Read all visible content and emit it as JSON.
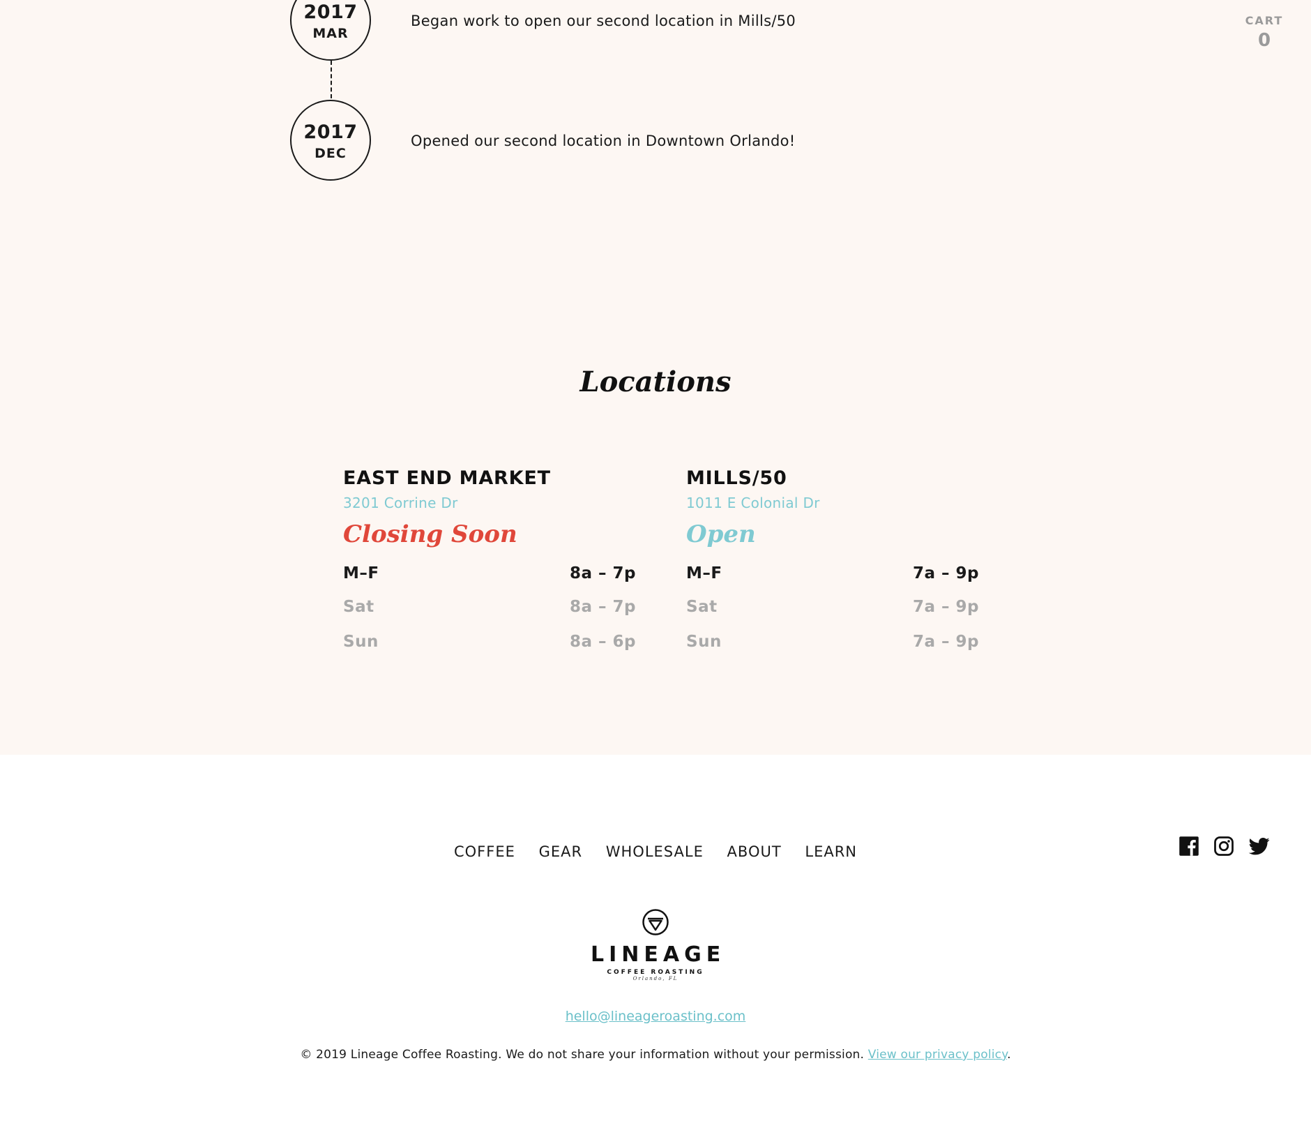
{
  "timeline": [
    {
      "year": "2017",
      "month": "MAR",
      "text": "Began work to open our second location in Mills/50"
    },
    {
      "year": "2017",
      "month": "DEC",
      "text": "Opened our second location in Downtown Orlando!"
    }
  ],
  "cart": {
    "label": "CART",
    "count": "0"
  },
  "locations": {
    "title": "Locations",
    "items": [
      {
        "name": "EAST END MARKET",
        "address": "3201 Corrine Dr",
        "status": "Closing Soon",
        "status_color": "#e0473a",
        "hours": [
          {
            "day": "M–F",
            "time": "8a – 7p"
          },
          {
            "day": "Sat",
            "time": "8a – 7p"
          },
          {
            "day": "Sun",
            "time": "8a – 6p"
          }
        ]
      },
      {
        "name": "MILLS/50",
        "address": "1011 E Colonial Dr",
        "status": "Open",
        "status_color": "#7fcad2",
        "hours": [
          {
            "day": "M–F",
            "time": "7a – 9p"
          },
          {
            "day": "Sat",
            "time": "7a – 9p"
          },
          {
            "day": "Sun",
            "time": "7a – 9p"
          }
        ]
      }
    ]
  },
  "footer": {
    "nav": [
      "COFFEE",
      "GEAR",
      "WHOLESALE",
      "ABOUT",
      "LEARN"
    ],
    "social": [
      "facebook-icon",
      "instagram-icon",
      "twitter-icon"
    ],
    "logo": {
      "word": "LINEAGE",
      "sub": "COFFEE ROASTING",
      "city": "Orlando, FL"
    },
    "email": "hello@lineageroasting.com",
    "legal_text": "© 2019 Lineage Coffee Roasting. We do not share your information without your permission.",
    "privacy_link": "View our privacy policy",
    "legal_end": "."
  },
  "colors": {
    "background_top": "#fdf7f3",
    "accent_teal": "#7fcad2",
    "accent_red": "#e0473a",
    "muted": "#a9a9a9"
  }
}
